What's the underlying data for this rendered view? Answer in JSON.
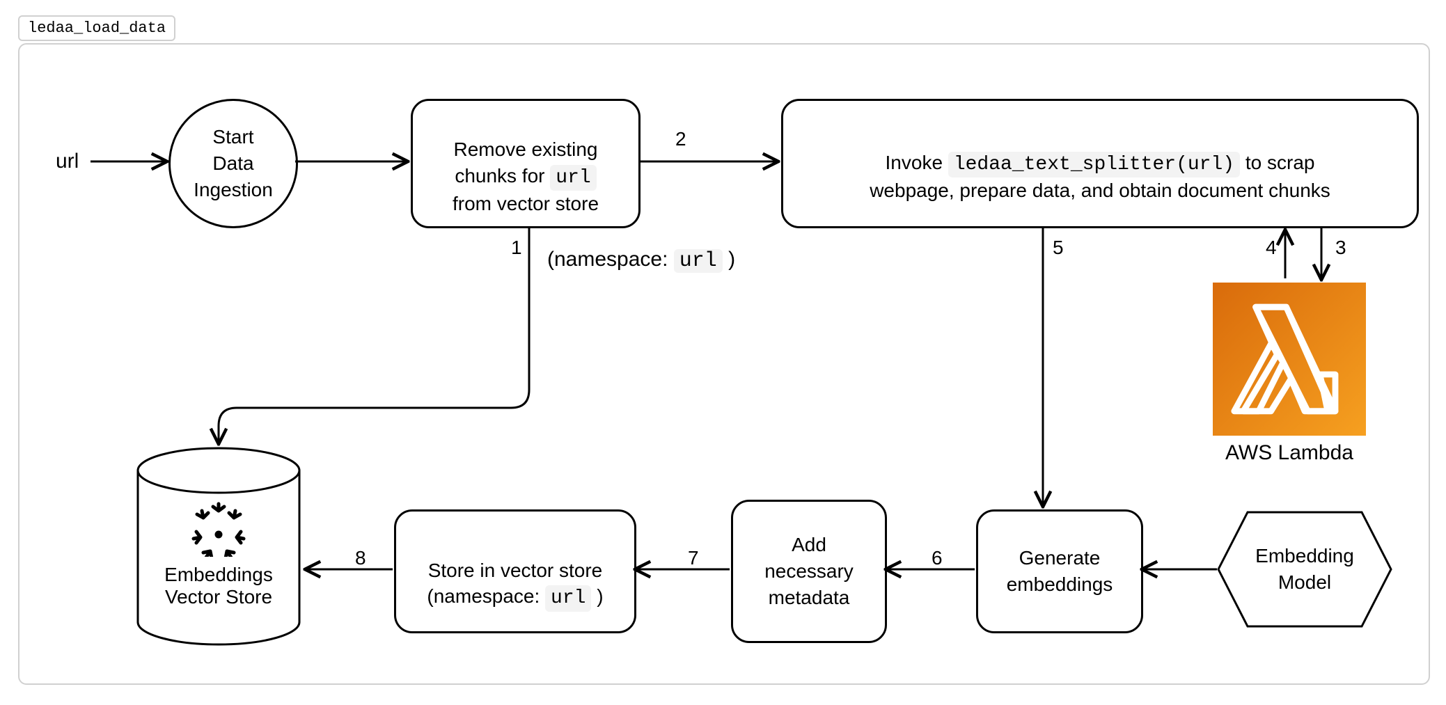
{
  "tab": "ledaa_load_data",
  "input_label": "url",
  "nodes": {
    "start": "Start\nData\nIngestion",
    "remove_pre": "Remove existing\nchunks for ",
    "remove_code": "url",
    "remove_post": "\nfrom vector store",
    "invoke_pre": "Invoke ",
    "invoke_code": "ledaa_text_splitter(url)",
    "invoke_post": " to scrap\nwebpage, prepare data, and obtain document chunks",
    "generate": "Generate\nembeddings",
    "metadata": "Add\nnecessary\nmetadata",
    "store_pre": "Store in vector store\n(namespace: ",
    "store_code": "url",
    "store_post": " )",
    "embed_model": "Embedding\nModel",
    "vector_store": "Embeddings\nVector Store",
    "lambda_caption": "AWS Lambda"
  },
  "edge_labels": {
    "e1": "1",
    "e1_note_pre": "(namespace: ",
    "e1_note_code": "url",
    "e1_note_post": " )",
    "e2": "2",
    "e3": "3",
    "e4": "4",
    "e5": "5",
    "e6": "6",
    "e7": "7",
    "e8": "8"
  }
}
